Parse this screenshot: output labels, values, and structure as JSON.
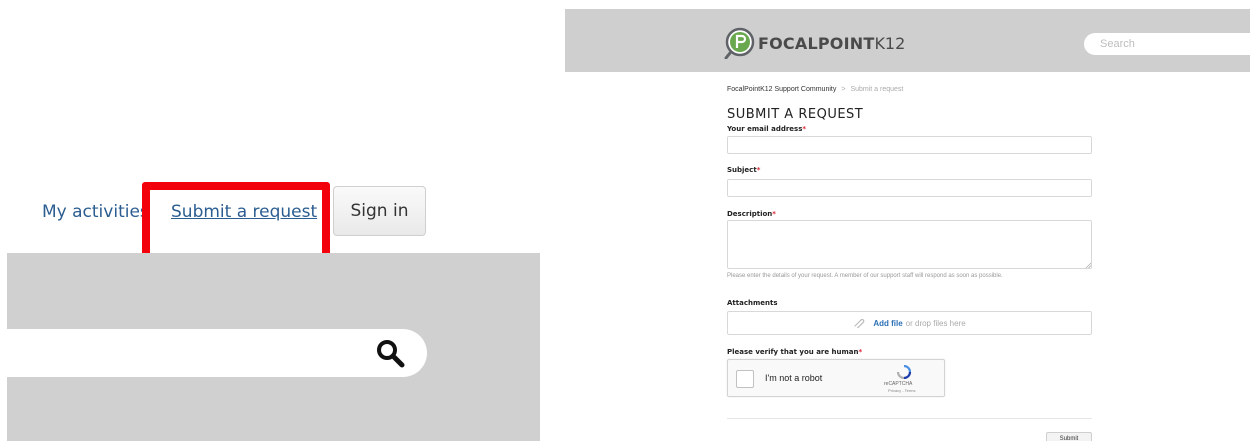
{
  "left_panel": {
    "nav": {
      "my_activities": "My activities",
      "submit_request": "Submit a request",
      "sign_in": "Sign in"
    },
    "highlight_color": "#f2000c",
    "search_icon": "search-icon"
  },
  "right_panel": {
    "header": {
      "logo_text": "FOCALPOINT",
      "logo_suffix": "K12",
      "search_placeholder": "Search"
    },
    "breadcrumb": {
      "home": "FocalPointK12 Support Community",
      "separator": ">",
      "current": "Submit a request"
    },
    "title": "SUBMIT A REQUEST",
    "form": {
      "email_label": "Your email address",
      "subject_label": "Subject",
      "description_label": "Description",
      "required_mark": "*",
      "description_help": "Please enter the details of your request. A member of our support staff will respond as soon as possible.",
      "attachments_label": "Attachments",
      "add_file": "Add file",
      "drop_text": "or drop files here",
      "verify_label": "Please verify that you are human",
      "captcha_text": "I'm not a robot",
      "captcha_brand": "reCAPTCHA",
      "captcha_links": "Privacy - Terms",
      "submit_label": "Submit"
    },
    "colors": {
      "header_bg": "#cfcfcf",
      "logo_green": "#6aa84f",
      "link_blue": "#2b6fb6",
      "required_red": "#dd2233"
    }
  }
}
